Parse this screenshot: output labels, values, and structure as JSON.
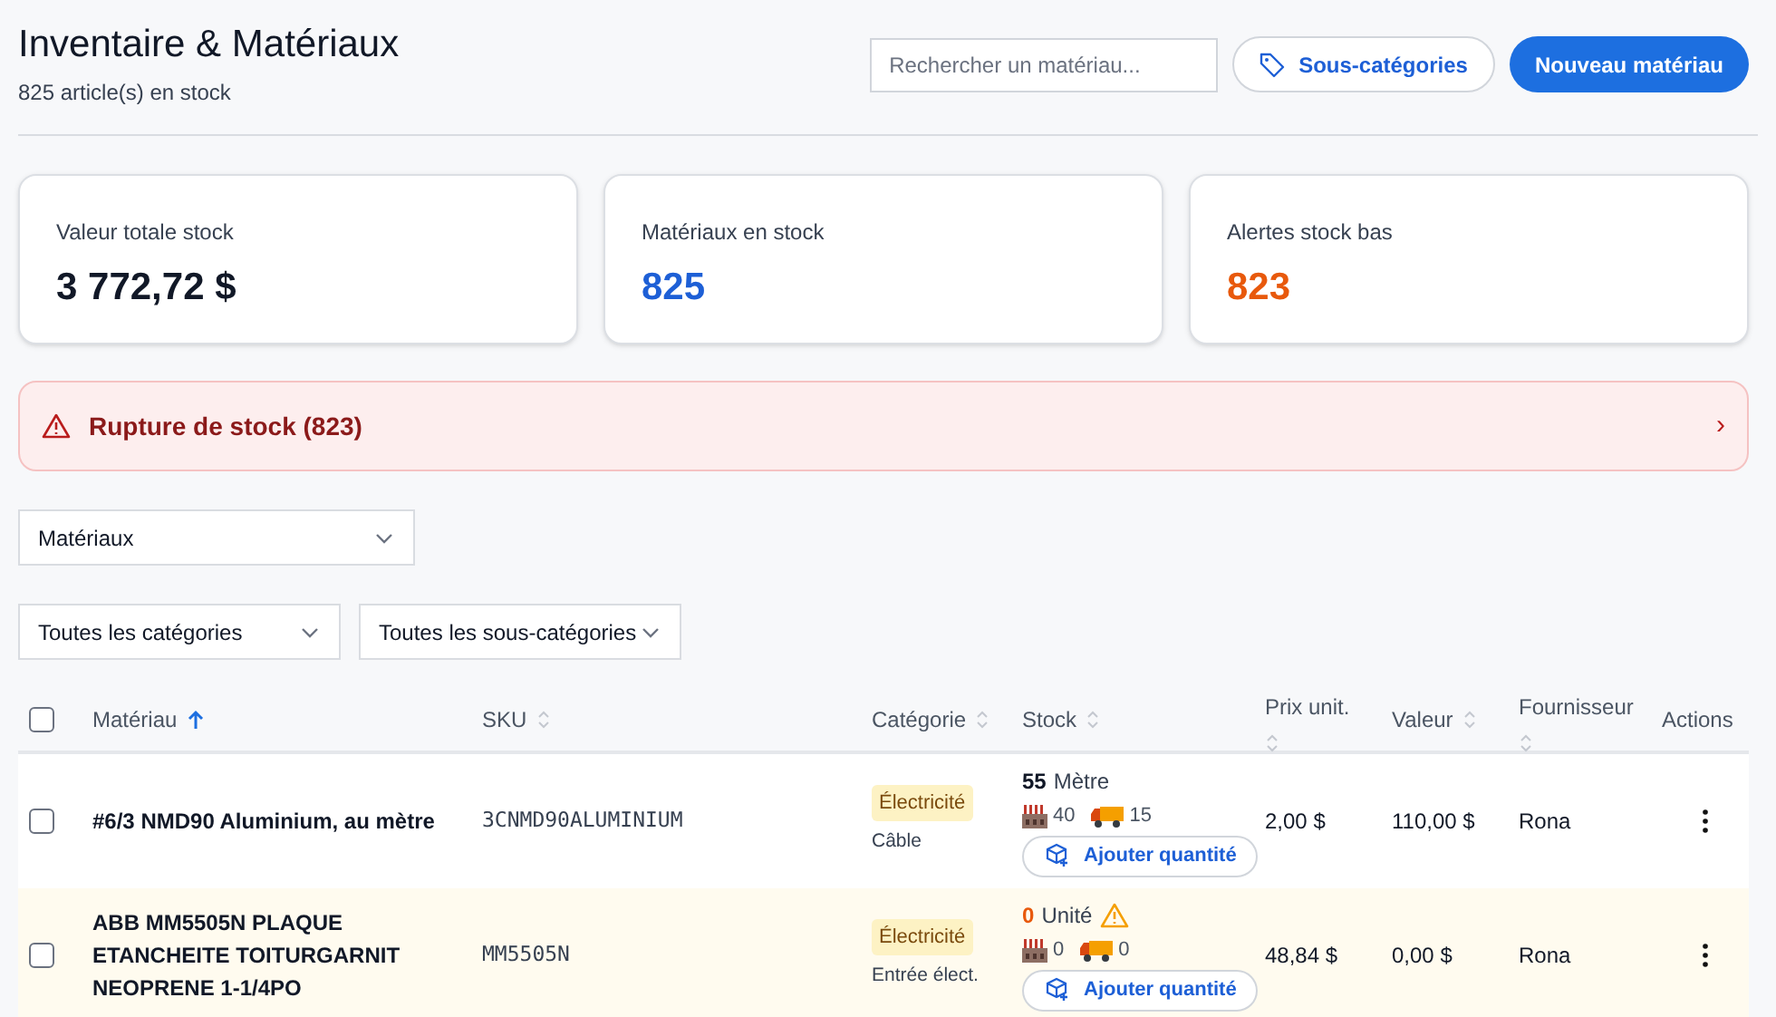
{
  "header": {
    "title": "Inventaire & Matériaux",
    "subtitle": "825 article(s) en stock",
    "search": {
      "placeholder": "Rechercher un matériau..."
    },
    "subcategories_button": "Sous-catégories",
    "new_button": "Nouveau matériau"
  },
  "stats": [
    {
      "label": "Valeur totale stock",
      "value": "3 772,72 $",
      "color": "#111827"
    },
    {
      "label": "Matériaux en stock",
      "value": "825",
      "color": "#1d5fd6"
    },
    {
      "label": "Alertes stock bas",
      "value": "823",
      "color": "#e8590c"
    }
  ],
  "alert": {
    "text": "Rupture de stock (823)",
    "chevron": "›"
  },
  "type_select": "Matériaux",
  "filters": [
    "Toutes les catégories",
    "Toutes les sous-catégories"
  ],
  "table": {
    "all_checked": false,
    "columns": [
      {
        "label": "Matériau",
        "sorted": true
      },
      {
        "label": "SKU",
        "sorted": false
      },
      {
        "label": "Catégorie",
        "sorted": false
      },
      {
        "label": "Stock",
        "sorted": false
      },
      {
        "label": "Prix unit.",
        "sorted": false
      },
      {
        "label": "Valeur",
        "sorted": false
      },
      {
        "label": "Fournisseur",
        "sorted": false
      },
      {
        "label": "Actions"
      }
    ],
    "rows": [
      {
        "checked": false,
        "low_stock": false,
        "name": "#6/3 NMD90 Aluminium, au mètre",
        "sku": "3CNMD90ALUMINIUM",
        "category": "Électricité",
        "subcategory": "Câble",
        "quantity": "55",
        "unit": "Mètre",
        "warehouse": "40",
        "truck": "15",
        "add_button": "Ajouter quantité",
        "price": "2,00 $",
        "value": "110,00 $",
        "supplier": "Rona"
      },
      {
        "checked": false,
        "low_stock": true,
        "name": "ABB MM5505N PLAQUE ETANCHEITE TOITURGARNIT NEOPRENE 1-1/4PO",
        "sku": "MM5505N",
        "category": "Électricité",
        "subcategory": "Entrée élect.",
        "quantity": "0",
        "unit": "Unité",
        "warehouse": "0",
        "truck": "0",
        "add_button": "Ajouter quantité",
        "price": "48,84 $",
        "value": "0,00 $",
        "supplier": "Rona"
      }
    ]
  }
}
